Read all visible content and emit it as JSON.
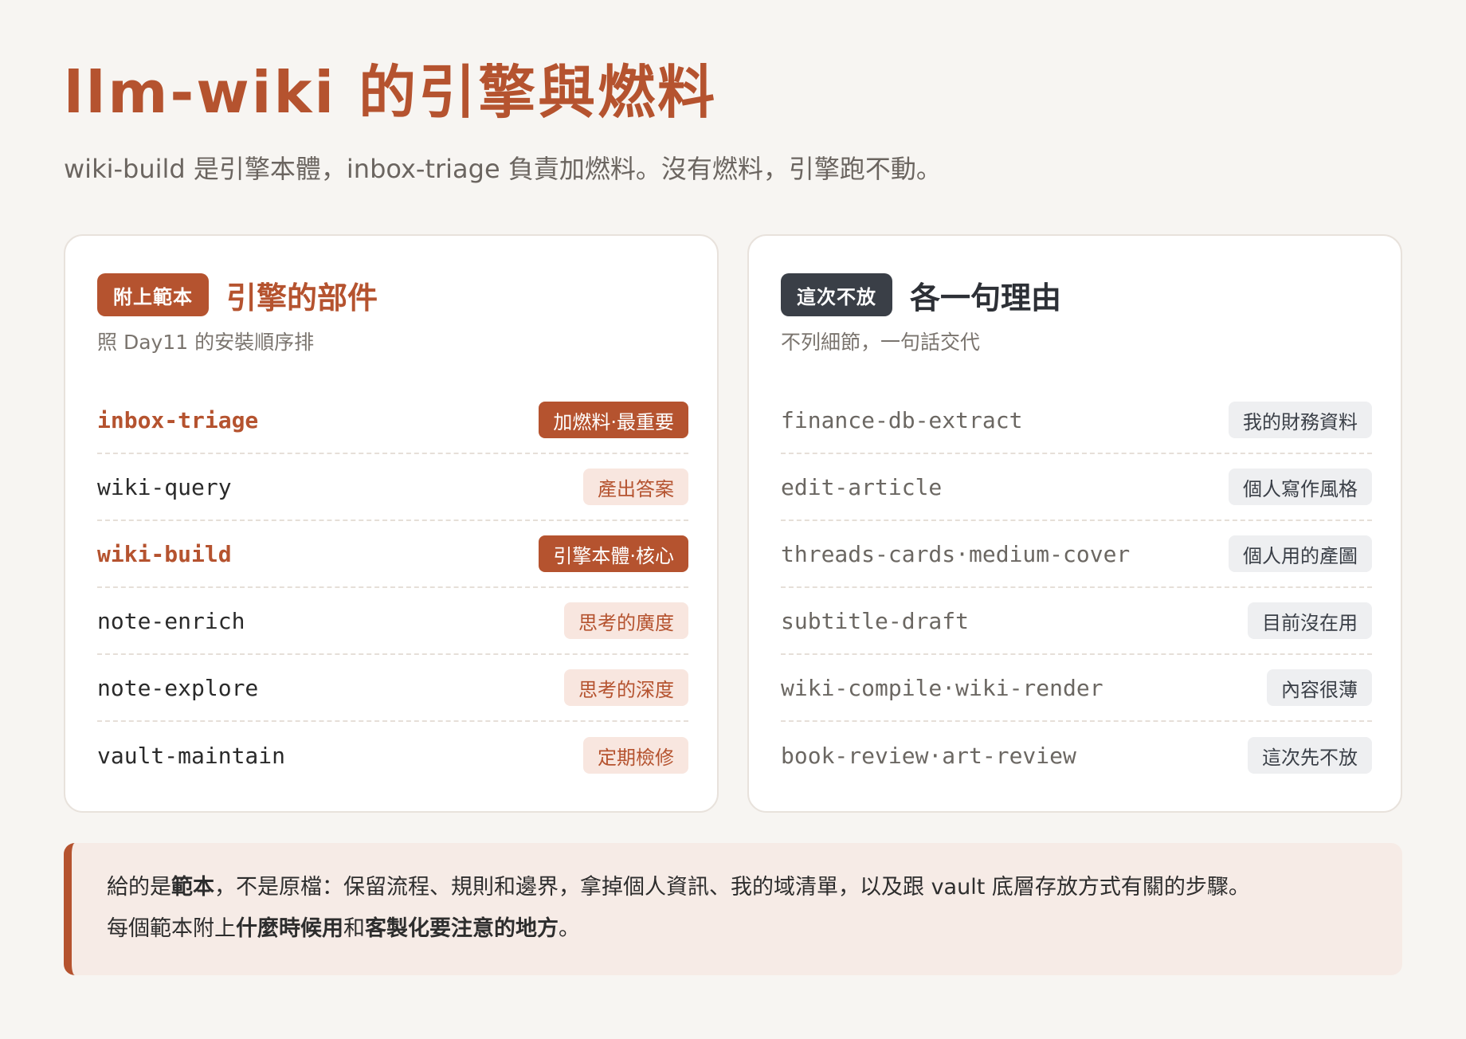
{
  "header": {
    "title": "llm-wiki 的引擎與燃料",
    "subtitle": "wiki-build 是引擎本體，inbox-triage 負責加燃料。沒有燃料，引擎跑不動。"
  },
  "left_card": {
    "badge": "附上範本",
    "title": "引擎的部件",
    "note": "照 Day11 的安裝順序排",
    "rows": [
      {
        "name": "inbox-triage",
        "tag": "加燃料·最重要"
      },
      {
        "name": "wiki-query",
        "tag": "產出答案"
      },
      {
        "name": "wiki-build",
        "tag": "引擎本體·核心"
      },
      {
        "name": "note-enrich",
        "tag": "思考的廣度"
      },
      {
        "name": "note-explore",
        "tag": "思考的深度"
      },
      {
        "name": "vault-maintain",
        "tag": "定期檢修"
      }
    ]
  },
  "right_card": {
    "badge": "這次不放",
    "title": "各一句理由",
    "note": "不列細節，一句話交代",
    "rows": [
      {
        "name": "finance-db-extract",
        "tag": "我的財務資料"
      },
      {
        "name": "edit-article",
        "tag": "個人寫作風格"
      },
      {
        "name": "threads-cards·medium-cover",
        "tag": "個人用的產圖"
      },
      {
        "name": "subtitle-draft",
        "tag": "目前沒在用"
      },
      {
        "name": "wiki-compile·wiki-render",
        "tag": "內容很薄"
      },
      {
        "name": "book-review·art-review",
        "tag": "這次先不放"
      }
    ]
  },
  "callout": {
    "line1_a": "給的是",
    "line1_b": "範本",
    "line1_c": "，不是原檔：保留流程、規則和邊界，拿掉個人資訊、我的域清單，以及跟 vault 底層存放方式有關的步驟。",
    "line2_a": "每個範本附上",
    "line2_b": "什麼時候用",
    "line2_c": "和",
    "line2_d": "客製化要注意的地方",
    "line2_e": "。"
  },
  "colors": {
    "accent": "#b5532f",
    "dark_badge": "#3a3f47",
    "background": "#f7f5f2"
  }
}
